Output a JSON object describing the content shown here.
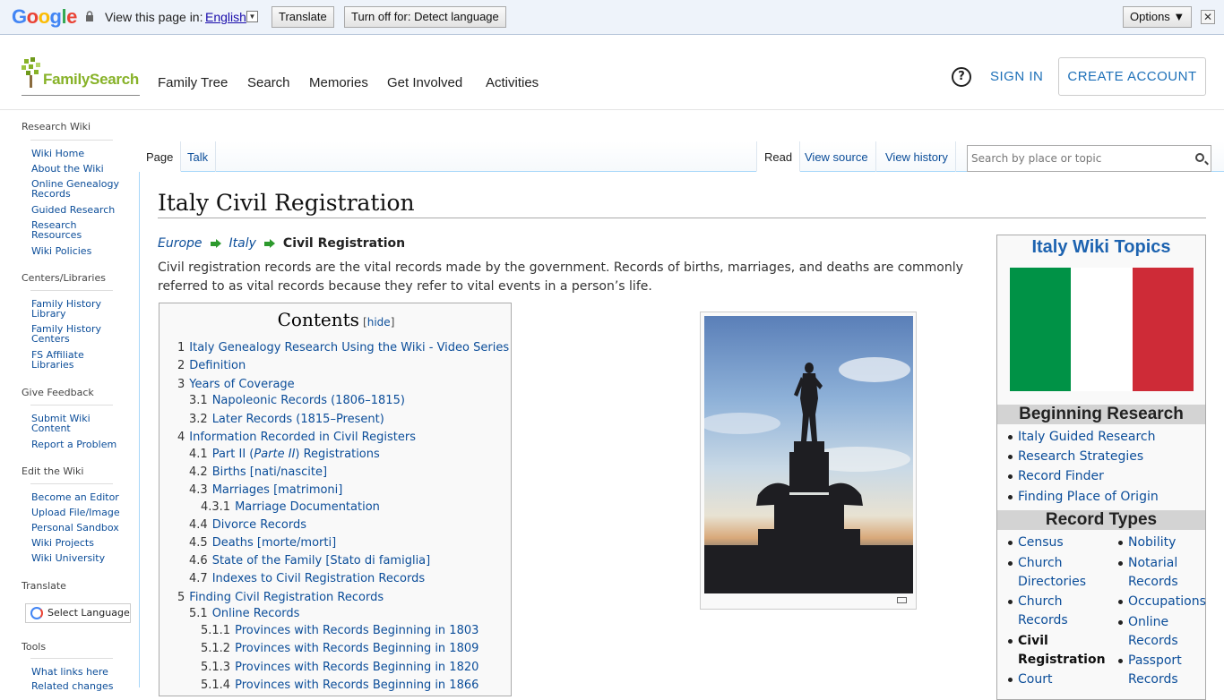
{
  "translate_bar": {
    "logo": "Google",
    "view_in": "View this page in:",
    "language": "English",
    "translate_btn": "Translate",
    "turn_off_btn": "Turn off for: Detect language",
    "options_btn": "Options ▼",
    "close": "✕"
  },
  "header": {
    "logo_text": "FamilySearch",
    "nav": [
      "Family Tree",
      "Search",
      "Memories",
      "Get Involved",
      "Activities"
    ],
    "help": "?",
    "sign_in": "SIGN IN",
    "create_account": "CREATE ACCOUNT"
  },
  "sidebar": {
    "sections": [
      {
        "title": "Research Wiki",
        "links": [
          [
            "Wiki Home"
          ],
          [
            "About the Wiki"
          ],
          [
            "Online Genealogy",
            "Records"
          ],
          [
            "Guided Research"
          ],
          [
            "Research",
            "Resources"
          ],
          [
            "Wiki Policies"
          ]
        ]
      },
      {
        "title": "Centers/Libraries",
        "links": [
          [
            "Family History",
            "Library"
          ],
          [
            "Family History",
            "Centers"
          ],
          [
            "FS Affiliate",
            "Libraries"
          ]
        ]
      },
      {
        "title": "Give Feedback",
        "links": [
          [
            "Submit Wiki",
            "Content"
          ],
          [
            "Report a Problem"
          ]
        ]
      },
      {
        "title": "Edit the Wiki",
        "links": [
          [
            "Become an Editor"
          ],
          [
            "Upload File/Image"
          ],
          [
            "Personal Sandbox"
          ],
          [
            "Wiki Projects"
          ],
          [
            "Wiki University"
          ]
        ]
      },
      {
        "title": "Translate",
        "links": []
      },
      {
        "title": "Tools",
        "links": [
          [
            "What links here"
          ],
          [
            "Related changes"
          ]
        ]
      }
    ],
    "select_language": "Select Language"
  },
  "tabs": {
    "page": "Page",
    "talk": "Talk",
    "read": "Read",
    "view_source": "View source",
    "view_history": "View history",
    "search_placeholder": "Search by place or topic"
  },
  "article": {
    "title": "Italy Civil Registration",
    "breadcrumb": [
      "Europe",
      "Italy",
      "Civil Registration"
    ],
    "intro": "Civil registration records are the vital records made by the government. Records of births, marriages, and deaths are commonly referred to as vital records because they refer to vital events in a person’s life."
  },
  "toc": {
    "title": "Contents",
    "hide": "hide",
    "items": [
      {
        "num": "1",
        "text": "Italy Genealogy Research Using the Wiki - Video Series",
        "level": 1
      },
      {
        "num": "2",
        "text": "Definition",
        "level": 1
      },
      {
        "num": "3",
        "text": "Years of Coverage",
        "level": 1
      },
      {
        "num": "3.1",
        "text": "Napoleonic Records (1806–1815)",
        "level": 2
      },
      {
        "num": "3.2",
        "text": "Later Records (1815–Present)",
        "level": 2
      },
      {
        "num": "4",
        "text": "Information Recorded in Civil Registers",
        "level": 1
      },
      {
        "num": "4.1",
        "text": "Part II (Parte II) Registrations",
        "level": 2
      },
      {
        "num": "4.2",
        "text": "Births [nati/nascite]",
        "level": 2
      },
      {
        "num": "4.3",
        "text": "Marriages [matrimoni]",
        "level": 2
      },
      {
        "num": "4.3.1",
        "text": "Marriage Documentation",
        "level": 3
      },
      {
        "num": "4.4",
        "text": "Divorce Records",
        "level": 2
      },
      {
        "num": "4.5",
        "text": "Deaths [morte/morti]",
        "level": 2
      },
      {
        "num": "4.6",
        "text": "State of the Family [Stato di famiglia]",
        "level": 2
      },
      {
        "num": "4.7",
        "text": "Indexes to Civil Registration Records",
        "level": 2
      },
      {
        "num": "5",
        "text": "Finding Civil Registration Records",
        "level": 1
      },
      {
        "num": "5.1",
        "text": "Online Records",
        "level": 2
      },
      {
        "num": "5.1.1",
        "text": "Provinces with Records Beginning in 1803",
        "level": 3
      },
      {
        "num": "5.1.2",
        "text": "Provinces with Records Beginning in 1809",
        "level": 3
      },
      {
        "num": "5.1.3",
        "text": "Provinces with Records Beginning in 1820",
        "level": 3
      },
      {
        "num": "5.1.4",
        "text": "Provinces with Records Beginning in 1866",
        "level": 3
      }
    ]
  },
  "infobox": {
    "title": "Italy Wiki Topics",
    "flag_colors": [
      "#009246",
      "#ffffff",
      "#ce2b37"
    ],
    "beginning_research": "Beginning Research",
    "beginning_links": [
      "Italy Guided Research",
      "Research Strategies",
      "Record Finder",
      "Finding Place of Origin"
    ],
    "record_types": "Record Types",
    "col1": [
      [
        "Census"
      ],
      [
        "Church",
        "Directories"
      ],
      [
        "Church",
        "Records"
      ],
      [
        "Civil",
        "Registration"
      ],
      [
        "Court"
      ]
    ],
    "col2": [
      [
        "Nobility"
      ],
      [
        "Notarial",
        "Records"
      ],
      [
        "Occupations"
      ],
      [
        "Online",
        "Records"
      ],
      [
        "Passport",
        "Records"
      ]
    ]
  }
}
